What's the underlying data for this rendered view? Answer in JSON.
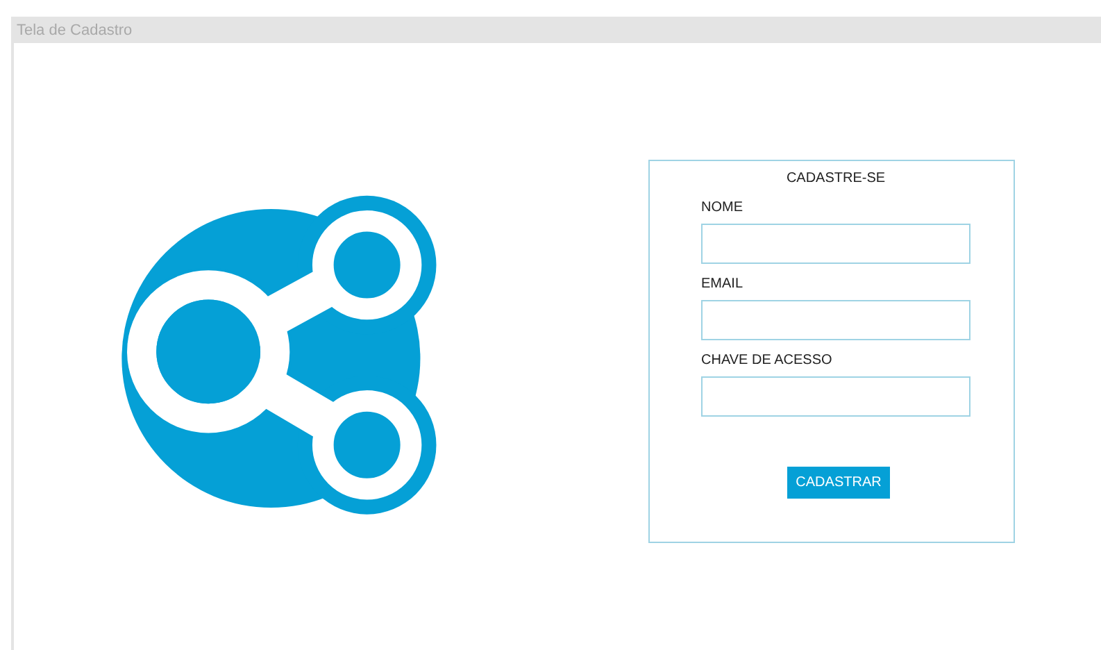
{
  "window": {
    "title": "Tela de Cadastro"
  },
  "form": {
    "heading": "CADASTRE-SE",
    "fields": [
      {
        "label": "NOME"
      },
      {
        "label": "EMAIL"
      },
      {
        "label": "CHAVE DE ACESSO"
      }
    ],
    "button": "CADASTRAR"
  }
}
